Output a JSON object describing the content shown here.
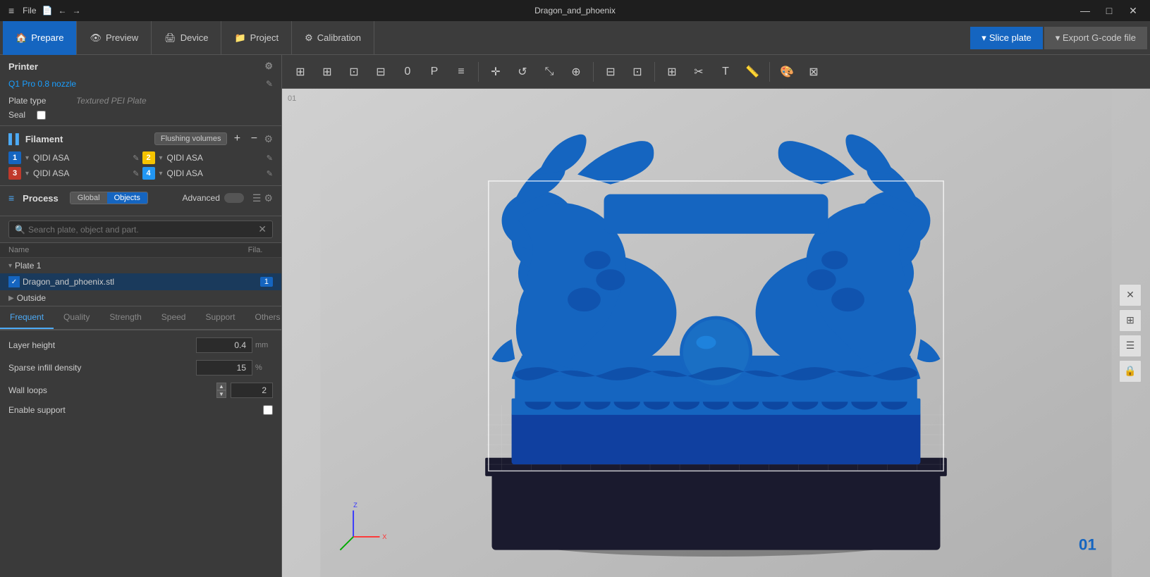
{
  "titlebar": {
    "title": "Dragon_and_phoenix",
    "file_icon": "📄",
    "back_icon": "←",
    "forward_icon": "→",
    "minimize": "—",
    "maximize": "□",
    "close": "✕",
    "menu": "≡",
    "file_label": "File"
  },
  "navbar": {
    "tabs": [
      {
        "id": "prepare",
        "label": "Prepare",
        "icon": "🏠",
        "active": true
      },
      {
        "id": "preview",
        "label": "Preview",
        "icon": "👁",
        "active": false
      },
      {
        "id": "device",
        "label": "Device",
        "icon": "🖨",
        "active": false
      },
      {
        "id": "project",
        "label": "Project",
        "icon": "📁",
        "active": false
      },
      {
        "id": "calibration",
        "label": "Calibration",
        "icon": "⚙",
        "active": false
      }
    ],
    "slice_btn": "Slice plate",
    "export_btn": "Export G-code file"
  },
  "printer": {
    "section_label": "Printer",
    "printer_name": "Q1 Pro 0.8 nozzle",
    "plate_type_label": "Plate type",
    "plate_type_value": "Textured PEI Plate",
    "seal_label": "Seal"
  },
  "filament": {
    "section_label": "Filament",
    "flushing_btn": "Flushing volumes",
    "items": [
      {
        "num": "1",
        "color": "#1565c0",
        "name": "QIDI ASA"
      },
      {
        "num": "2",
        "color": "#f5c300",
        "name": "QIDI ASA"
      },
      {
        "num": "3",
        "color": "#c0392b",
        "name": "QIDI ASA"
      },
      {
        "num": "4",
        "color": "#2196f3",
        "name": "QIDI ASA"
      }
    ]
  },
  "process": {
    "section_label": "Process",
    "global_label": "Global",
    "objects_label": "Objects",
    "advanced_label": "Advanced"
  },
  "search": {
    "placeholder": "Search plate, object and part."
  },
  "object_list": {
    "col_name": "Name",
    "col_fila": "Fila.",
    "plate_label": "Plate 1",
    "object_name": "Dragon_and_phoenix.stl",
    "outside_label": "Outside"
  },
  "tabs": {
    "items": [
      {
        "id": "frequent",
        "label": "Frequent",
        "active": true
      },
      {
        "id": "quality",
        "label": "Quality",
        "active": false
      },
      {
        "id": "strength",
        "label": "Strength",
        "active": false
      },
      {
        "id": "speed",
        "label": "Speed",
        "active": false
      },
      {
        "id": "support",
        "label": "Support",
        "active": false
      },
      {
        "id": "others",
        "label": "Others",
        "active": false
      }
    ]
  },
  "settings": {
    "layer_height_label": "Layer height",
    "layer_height_value": "0.4",
    "layer_height_unit": "mm",
    "sparse_infill_label": "Sparse infill density",
    "sparse_infill_value": "15",
    "sparse_infill_unit": "%",
    "wall_loops_label": "Wall loops",
    "wall_loops_value": "2",
    "enable_support_label": "Enable support"
  },
  "viewport": {
    "coords": "01",
    "plate_num": "01"
  },
  "colors": {
    "blue": "#1565c0",
    "yellow": "#f5c300",
    "red": "#c0392b",
    "light_blue": "#2196f3",
    "model_blue": "#1565c0",
    "active_tab": "#4dabf7"
  }
}
